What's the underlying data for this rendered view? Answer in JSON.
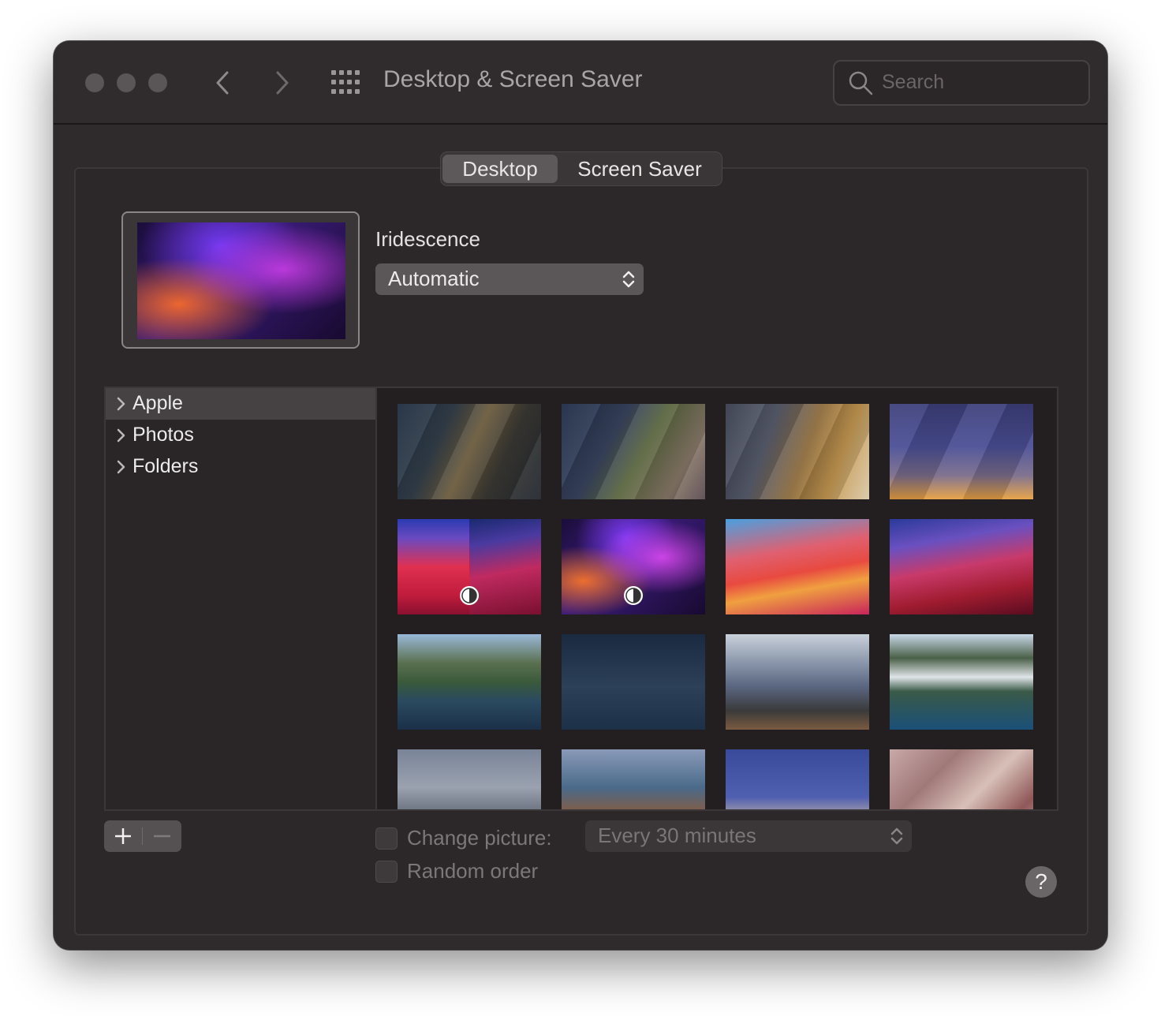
{
  "window": {
    "title": "Desktop & Screen Saver",
    "search_placeholder": "Search"
  },
  "tabs": [
    {
      "label": "Desktop",
      "active": true
    },
    {
      "label": "Screen Saver",
      "active": false
    }
  ],
  "current_wallpaper": {
    "name": "Iridescence",
    "mode": "Automatic"
  },
  "sidebar": {
    "items": [
      {
        "label": "Apple",
        "selected": true
      },
      {
        "label": "Photos",
        "selected": false
      },
      {
        "label": "Folders",
        "selected": false
      }
    ]
  },
  "wallpapers": [
    {
      "name": "big-sur-dynamic",
      "icon": "none"
    },
    {
      "name": "catalina-dynamic",
      "icon": "none"
    },
    {
      "name": "mojave-dynamic",
      "icon": "none"
    },
    {
      "name": "solar-gradients",
      "icon": "none"
    },
    {
      "name": "big-sur-graphic",
      "icon": "light-dark-icon"
    },
    {
      "name": "iridescence",
      "icon": "light-dark-icon"
    },
    {
      "name": "big-sur-graphic-light",
      "icon": "none"
    },
    {
      "name": "big-sur-graphic-dark",
      "icon": "none"
    },
    {
      "name": "big-sur-coastline",
      "icon": "none"
    },
    {
      "name": "big-sur-night",
      "icon": "none"
    },
    {
      "name": "big-sur-mountains",
      "icon": "none"
    },
    {
      "name": "big-sur-aerial",
      "icon": "none"
    },
    {
      "name": "big-sur-rocks",
      "icon": "none"
    },
    {
      "name": "big-sur-cove",
      "icon": "none"
    },
    {
      "name": "big-sur-tower",
      "icon": "none"
    },
    {
      "name": "big-sur-stone",
      "icon": "none"
    }
  ],
  "options": {
    "change_picture_label": "Change picture:",
    "change_picture_checked": false,
    "interval": "Every 30 minutes",
    "random_order_label": "Random order",
    "random_order_checked": false
  },
  "buttons": {
    "add": "+",
    "remove": "−",
    "help": "?"
  },
  "colors": {
    "window_bg": "#2f2a2b",
    "selected_row": "#464142",
    "popup_bg": "#5b5657"
  }
}
